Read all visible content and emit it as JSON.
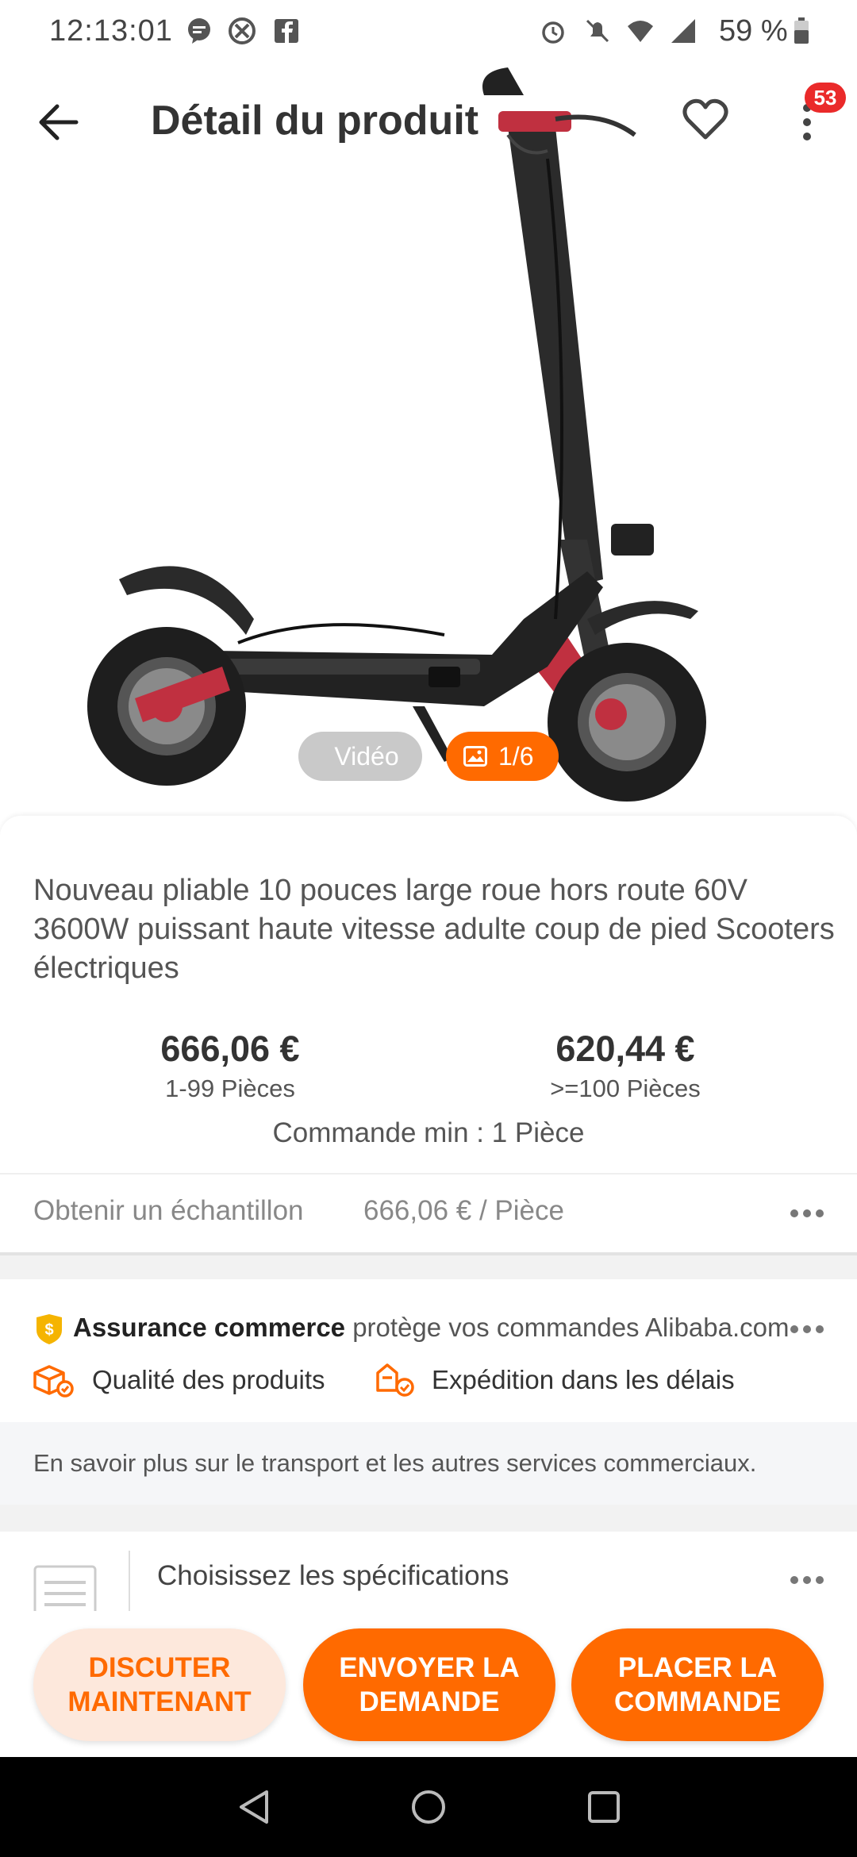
{
  "status_bar": {
    "time": "12:13:01",
    "battery": "59 %"
  },
  "header": {
    "title": "Détail du produit",
    "badge_count": "53"
  },
  "gallery": {
    "video_label": "Vidéo",
    "image_counter": "1/6"
  },
  "product": {
    "title": "Nouveau pliable 10 pouces large roue hors route 60V 3600W puissant haute vitesse adulte coup de pied Scooters électriques",
    "prices": [
      {
        "price": "666,06 €",
        "quantity": "1-99 Pièces"
      },
      {
        "price": "620,44 €",
        "quantity": ">=100 Pièces"
      }
    ],
    "min_order": "Commande min : 1 Pièce",
    "sample": {
      "label": "Obtenir un échantillon",
      "price": "666,06 € / Pièce"
    }
  },
  "assurance": {
    "name": "Assurance commerce",
    "description": "protège vos commandes Alibaba.com",
    "features": [
      "Qualité des produits",
      "Expédition dans les délais"
    ],
    "learn_more": "En savoir plus sur le transport et les autres services commerciaux."
  },
  "specs": {
    "label": "Choisissez les spécifications"
  },
  "actions": {
    "chat_line1": "DISCUTER",
    "chat_line2": "MAINTENANT",
    "inquiry_line1": "ENVOYER LA",
    "inquiry_line2": "DEMANDE",
    "order_line1": "PLACER LA",
    "order_line2": "COMMANDE"
  },
  "colors": {
    "accent": "#ff6a00",
    "badge": "#ea2a2a",
    "assurance_gold": "#f5b400"
  },
  "icons": {
    "back": "arrow-left-icon",
    "favorite": "heart-icon",
    "more": "more-vert-icon",
    "shield": "trade-assurance-icon"
  }
}
